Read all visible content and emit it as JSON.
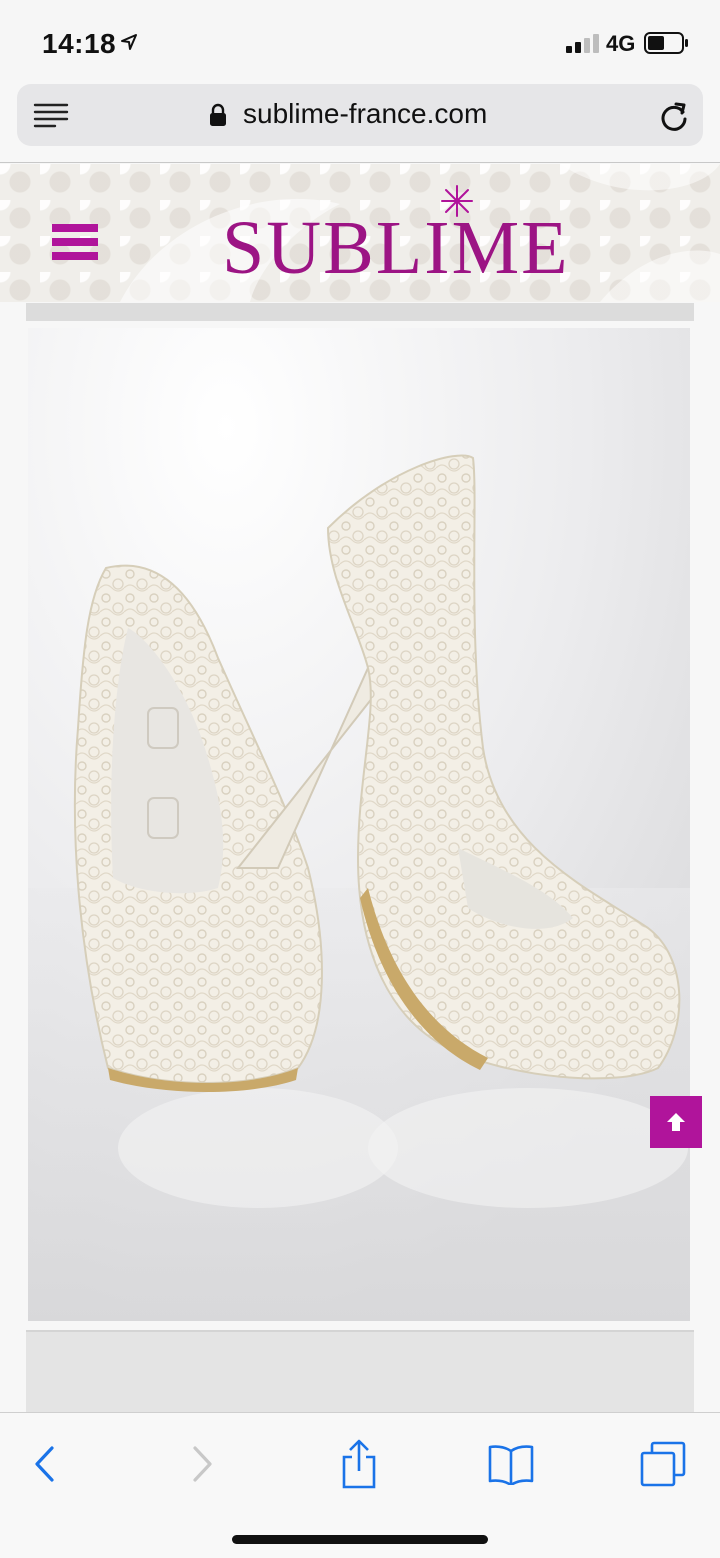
{
  "status_bar": {
    "time": "14:18",
    "network": "4G",
    "location_icon": "location-arrow-icon",
    "signal_icon": "signal-icon",
    "battery_icon": "battery-icon"
  },
  "browser": {
    "url": "sublime-france.com",
    "reader_icon": "reader-mode-icon",
    "lock_icon": "lock-icon",
    "reload_icon": "reload-icon"
  },
  "site": {
    "logo_text": "SUBLIME",
    "brand_color": "#b0149b",
    "menu_icon": "hamburger-menu-icon"
  },
  "product": {
    "image_subject": "white lace platform high-heel pumps"
  },
  "scroll_top": {
    "icon": "arrow-up-icon"
  },
  "toolbar": {
    "items": [
      {
        "name": "back",
        "icon": "chevron-left-icon",
        "enabled": true
      },
      {
        "name": "forward",
        "icon": "chevron-right-icon",
        "enabled": false
      },
      {
        "name": "share",
        "icon": "share-icon",
        "enabled": true
      },
      {
        "name": "bookmarks",
        "icon": "book-icon",
        "enabled": true
      },
      {
        "name": "tabs",
        "icon": "tabs-icon",
        "enabled": true
      }
    ],
    "accent_color": "#1a73e8"
  }
}
